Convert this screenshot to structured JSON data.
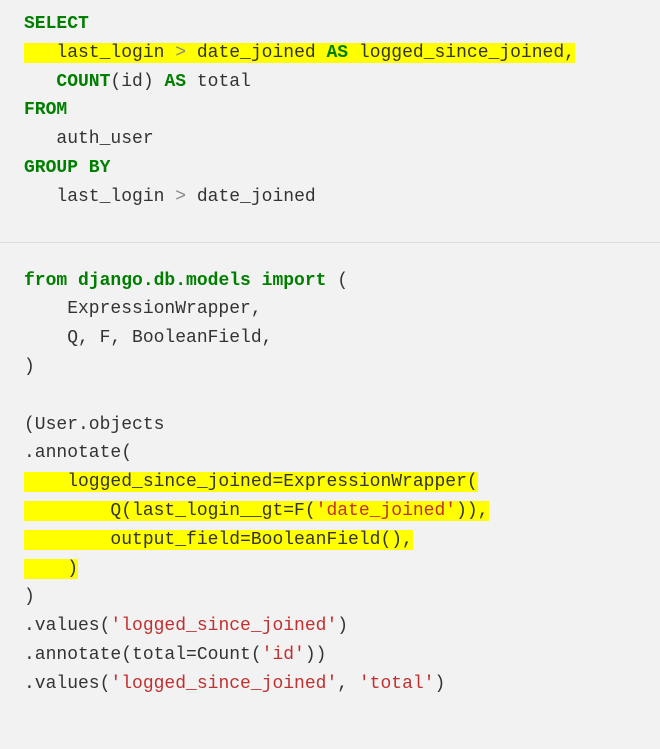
{
  "sql": {
    "l1": "SELECT",
    "l2a": "   last_login ",
    "l2b": " date_joined ",
    "l2c": "AS",
    "l2d": " logged_since_joined,",
    "l3a": "   ",
    "l3b": "COUNT",
    "l3c": "(id) ",
    "l3d": "AS",
    "l3e": " total",
    "l4": "FROM",
    "l5": "   auth_user",
    "l6": "GROUP BY",
    "l7a": "   last_login ",
    "l7b": " date_joined"
  },
  "py": {
    "l1a": "from",
    "l1b": " django.db.models ",
    "l1c": "import",
    "l1d": " (",
    "l2": "    ExpressionWrapper,",
    "l3": "    Q, F, BooleanField,",
    "l4": ")",
    "l5": "",
    "l6": "(User.objects",
    "l7": ".annotate(",
    "l8a": "    logged_since_joined=ExpressionWrapper(",
    "l9a": "        Q(last_login__gt=F(",
    "l9b": "'date_joined'",
    "l9c": ")),",
    "l10": "        output_field=BooleanField(),",
    "l11a": "    )",
    "l12": ")",
    "l13a": ".values(",
    "l13b": "'logged_since_joined'",
    "l13c": ")",
    "l14a": ".annotate(total=Count(",
    "l14b": "'id'",
    "l14c": "))",
    "l15a": ".values(",
    "l15b": "'logged_since_joined'",
    "l15c": ", ",
    "l15d": "'total'",
    "l15e": ")"
  },
  "gt": ">"
}
